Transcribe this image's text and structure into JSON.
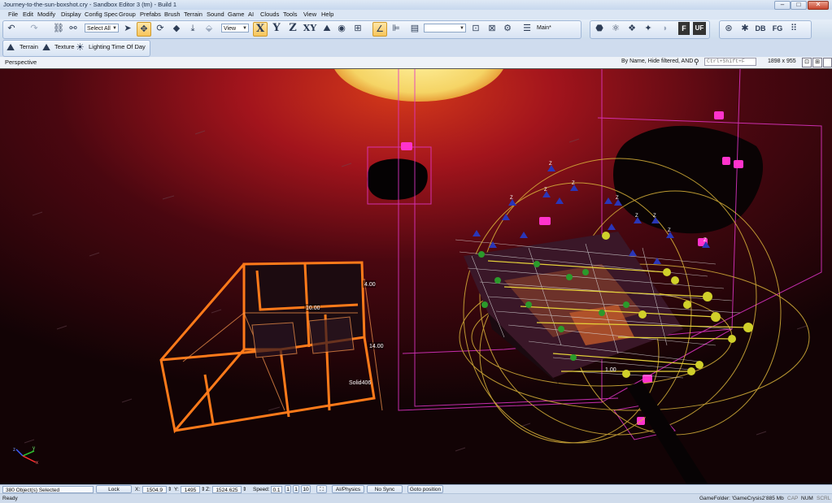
{
  "window": {
    "title": "Journey-to-the-sun-boxshot.cry - Sandbox Editor 3 (tm) - Build 1",
    "buttons": {
      "minimize": "–",
      "maximize": "□",
      "close": "✕"
    }
  },
  "menubar": [
    "File",
    "Edit",
    "Modify",
    "Display",
    "Config Spec",
    "Group",
    "Prefabs",
    "Brush",
    "Terrain",
    "Sound",
    "Game",
    "AI",
    "Clouds",
    "Tools",
    "View",
    "Help"
  ],
  "toolbar": {
    "selection_combo": "Select All",
    "coord_combo": "View",
    "axis_buttons": [
      "X",
      "Y",
      "Z",
      "XY"
    ],
    "layer_combo": "",
    "layer_label": "Main*",
    "right_labels": [
      "F",
      "UF",
      "DB",
      "FG"
    ],
    "active_axis": "X"
  },
  "toolbar2": {
    "items": [
      "Terrain",
      "Texture",
      "Lighting",
      "Time Of Day"
    ]
  },
  "viewport": {
    "name": "Perspective",
    "filter_text": "By Name, Hide filtered, AND",
    "search_placeholder": "Ctrl+Shift+F",
    "resolution": "1898 x 955",
    "scene_labels": {
      "dim_a": "4.00",
      "dim_b": "10.00",
      "dim_c": "14.00",
      "solid": "Solid406",
      "misc": "1.00"
    }
  },
  "statusbar": {
    "selection": "380 Object(s) Selected",
    "lock_selection": "Lock Selection",
    "x_label": "X:",
    "x_value": "1504.9",
    "y_label": "Y:",
    "y_value": "1495",
    "z_label": "Z:",
    "z_value": "1524.625",
    "speed_label": "Speed:",
    "speed_value": "0.1",
    "speed_presets": [
      "1",
      "1",
      "10"
    ],
    "ai_physics": "AI/Physics",
    "sync_player": "No Sync Player",
    "goto_position": "Goto position",
    "ready": "Ready",
    "game_folder": "GameFolder: 'GameCrysis2'",
    "memory": "885 Mb",
    "cap": "CAP",
    "num": "NUM",
    "scrl": "SCRL"
  },
  "colors": {
    "accent": "#f7c45a",
    "wireframe": "#ff7a1a",
    "selection": "#ff33cc",
    "gizmo": "#e6d23a"
  }
}
